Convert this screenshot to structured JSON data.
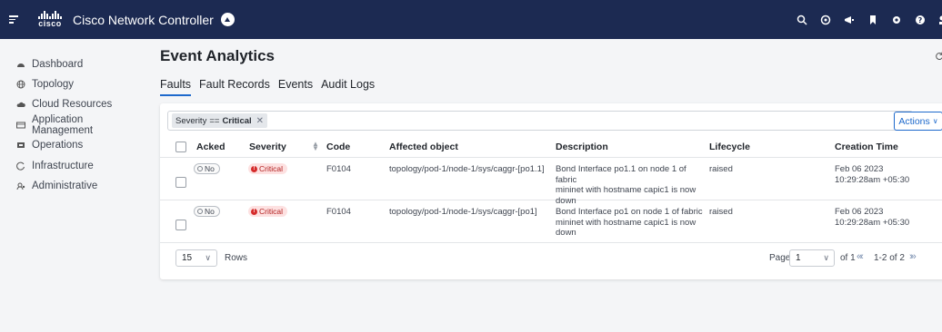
{
  "header": {
    "app_title": "Cisco Network Controller",
    "logo_text": "cisco",
    "icons": [
      "search-icon",
      "assistant-icon",
      "announcement-icon",
      "bookmark-icon",
      "settings-icon",
      "help-icon",
      "user-icon"
    ]
  },
  "sidebar": {
    "items": [
      {
        "label": "Dashboard",
        "icon": "dashboard-icon"
      },
      {
        "label": "Topology",
        "icon": "globe-icon"
      },
      {
        "label": "Cloud Resources",
        "icon": "cloud-icon"
      },
      {
        "label": "Application Management",
        "icon": "app-window-icon"
      },
      {
        "label": "Operations",
        "icon": "operations-icon"
      },
      {
        "label": "Infrastructure",
        "icon": "infrastructure-icon"
      },
      {
        "label": "Administrative",
        "icon": "admin-icon"
      }
    ]
  },
  "page": {
    "title": "Event Analytics",
    "tabs": [
      "Faults",
      "Fault Records",
      "Events",
      "Audit Logs"
    ],
    "active_tab": "Faults"
  },
  "filter": {
    "chip_field": "Severity",
    "chip_operator": "==",
    "chip_value": "Critical",
    "actions_label": "Actions"
  },
  "table": {
    "headers": {
      "acked": "Acked",
      "severity": "Severity",
      "code": "Code",
      "affected": "Affected object",
      "description": "Description",
      "lifecycle": "Lifecycle",
      "created": "Creation Time"
    },
    "rows": [
      {
        "acked": "No",
        "severity": "Critical",
        "code": "F0104",
        "affected": "topology/pod-1/node-1/sys/caggr-[po1.1]",
        "description": [
          "Bond Interface po1.1 on node 1 of fabric",
          "mininet with hostname capic1 is now",
          "down"
        ],
        "lifecycle": "raised",
        "created": [
          "Feb 06 2023",
          "10:29:28am +05:30"
        ]
      },
      {
        "acked": "No",
        "severity": "Critical",
        "code": "F0104",
        "affected": "topology/pod-1/node-1/sys/caggr-[po1]",
        "description": [
          "Bond Interface po1 on node 1 of fabric",
          "mininet with hostname capic1 is now",
          "down"
        ],
        "lifecycle": "raised",
        "created": [
          "Feb 06 2023",
          "10:29:28am +05:30"
        ]
      }
    ]
  },
  "pagination": {
    "rows_per_page": "15",
    "rows_label": "Rows",
    "page_label": "Page",
    "current_page": "1",
    "of_label": "of 1",
    "range_label": "1-2 of 2"
  },
  "colors": {
    "header_bg": "#1c2a52",
    "accent": "#1d69cc",
    "critical": "#d52b2b"
  }
}
